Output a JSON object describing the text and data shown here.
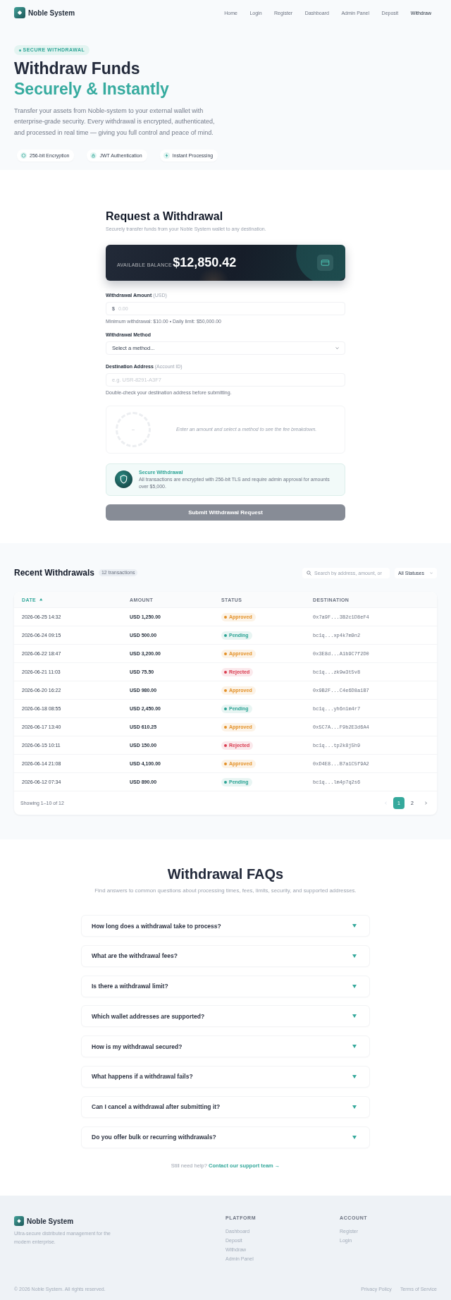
{
  "header": {
    "brand": "Noble System",
    "nav": [
      {
        "label": "Home",
        "selected": false
      },
      {
        "label": "Login",
        "selected": false
      },
      {
        "label": "Register",
        "selected": false
      },
      {
        "label": "Dashboard",
        "selected": false
      },
      {
        "label": "Admin Panel",
        "selected": false
      },
      {
        "label": "Deposit",
        "selected": false
      },
      {
        "label": "Withdraw",
        "selected": true
      }
    ]
  },
  "hero": {
    "badge": "SECURE WITHDRAWAL",
    "title": "Withdraw Funds",
    "title_accent": "Securely & Instantly",
    "description": "Transfer your assets from Noble-system to your external wallet with enterprise-grade security. Every withdrawal is encrypted, authenticated, and processed in real time — giving you full control and peace of mind.",
    "features": [
      "256-bit Encryption",
      "JWT Authentication",
      "Instant Processing"
    ]
  },
  "form": {
    "title": "Request a Withdrawal",
    "subtitle": "Securely transfer funds from your Noble System wallet to any destination.",
    "balance": {
      "label": "AVAILABLE BALANCE",
      "amount": "$12,850.42"
    },
    "amount_field": {
      "label": "Withdrawal Amount",
      "label_note": "(USD)",
      "prefix": "$",
      "placeholder": "0.00",
      "hint": "Minimum withdrawal: $10.00 • Daily limit: $50,000.00"
    },
    "method_field": {
      "label": "Withdrawal Method",
      "value": "Select a method..."
    },
    "destination_field": {
      "label": "Destination Address",
      "label_note": "(Account ID)",
      "placeholder": "e.g. USR-8291-A3F7",
      "hint": "Double-check your destination address before submitting."
    },
    "fee_panel": {
      "ring_value": "–",
      "message": "Enter an amount and select a method to see the fee breakdown."
    },
    "notice": {
      "title": "Secure Withdrawal",
      "text": "All transactions are encrypted with 256-bit TLS and require admin approval for amounts over $5,000."
    },
    "submit": {
      "label": "Submit Withdrawal Request",
      "disabled": true
    }
  },
  "withdrawals": {
    "title": "Recent Withdrawals",
    "count": "12 transactions",
    "search": {
      "placeholder": "Search by address, amount, or"
    },
    "status_filter": {
      "value": "All Statuses"
    },
    "columns": [
      {
        "label": "DATE",
        "sorted": true
      },
      {
        "label": "AMOUNT",
        "sorted": false
      },
      {
        "label": "STATUS",
        "sorted": false
      },
      {
        "label": "DESTINATION",
        "sorted": false
      }
    ],
    "rows": [
      {
        "date": "2026-06-25 14:32",
        "amount": "USD 1,250.00",
        "status": {
          "label": "Approved",
          "color": "#e39128"
        },
        "destination": "0x7a9F...3B2c1D8eF4"
      },
      {
        "date": "2026-06-24 09:15",
        "amount": "USD 500.00",
        "status": {
          "label": "Pending",
          "color": "#2ba394"
        },
        "destination": "bc1q...xp4k7m9n2"
      },
      {
        "date": "2026-06-22 18:47",
        "amount": "USD 3,200.00",
        "status": {
          "label": "Approved",
          "color": "#e39128"
        },
        "destination": "0x3E8d...A1b9C7f2D0"
      },
      {
        "date": "2026-06-21 11:03",
        "amount": "USD 75.50",
        "status": {
          "label": "Rejected",
          "color": "#d93b4f"
        },
        "destination": "bc1q...zk9w3t5v8"
      },
      {
        "date": "2026-06-20 16:22",
        "amount": "USD 980.00",
        "status": {
          "label": "Approved",
          "color": "#e39128"
        },
        "destination": "0x9B2F...C4e6D8a1B7"
      },
      {
        "date": "2026-06-18 08:55",
        "amount": "USD 2,450.00",
        "status": {
          "label": "Pending",
          "color": "#2ba394"
        },
        "destination": "bc1q...yh6n1m4r7"
      },
      {
        "date": "2026-06-17 13:40",
        "amount": "USD 610.25",
        "status": {
          "label": "Approved",
          "color": "#e39128"
        },
        "destination": "0x5C7A...F9b2E3d6A4"
      },
      {
        "date": "2026-06-15 10:11",
        "amount": "USD 150.00",
        "status": {
          "label": "Rejected",
          "color": "#d93b4f"
        },
        "destination": "bc1q...tp2k8j5h9"
      },
      {
        "date": "2026-06-14 21:08",
        "amount": "USD 4,100.00",
        "status": {
          "label": "Approved",
          "color": "#e39128"
        },
        "destination": "0xD4E8...B7a1C5f9A2"
      },
      {
        "date": "2026-06-12 07:34",
        "amount": "USD 890.00",
        "status": {
          "label": "Pending",
          "color": "#2ba394"
        },
        "destination": "bc1q...lm4p7q2s6"
      }
    ],
    "pagination": {
      "summary": "Showing 1–10 of 12",
      "prev": {
        "disabled": true
      },
      "next": {
        "disabled": false
      },
      "pages": [
        {
          "label": "1",
          "selected": true
        },
        {
          "label": "2",
          "selected": false
        }
      ]
    }
  },
  "faq": {
    "title": "Withdrawal FAQs",
    "subtitle": "Find answers to common questions about processing times, fees, limits, security, and supported addresses.",
    "items": [
      "How long does a withdrawal take to process?",
      "What are the withdrawal fees?",
      "Is there a withdrawal limit?",
      "Which wallet addresses are supported?",
      "How is my withdrawal secured?",
      "What happens if a withdrawal fails?",
      "Can I cancel a withdrawal after submitting it?",
      "Do you offer bulk or recurring withdrawals?"
    ],
    "help": {
      "text": "Still need help?",
      "link": "Contact our support team →"
    }
  },
  "footer": {
    "brand": "Noble System",
    "tagline": "Ultra-secure distributed management for the modern enterprise.",
    "columns": [
      {
        "heading": "PLATFORM",
        "links": [
          "Dashboard",
          "Deposit",
          "Withdraw",
          "Admin Panel"
        ]
      },
      {
        "heading": "ACCOUNT",
        "links": [
          "Register",
          "Login"
        ]
      }
    ],
    "copyright": "© 2026 Noble System. All rights reserved.",
    "legal_links": [
      "Privacy Policy",
      "Terms of Service"
    ]
  }
}
